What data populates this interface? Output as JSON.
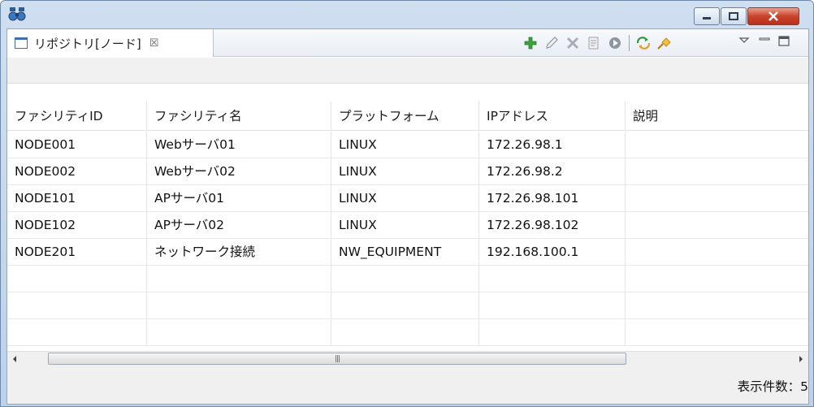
{
  "view": {
    "tab_title": "リポジトリ[ノード]",
    "tab_close_glyph": "☒"
  },
  "toolbar": {
    "items": [
      {
        "name": "add-icon"
      },
      {
        "name": "edit-icon"
      },
      {
        "name": "delete-icon"
      },
      {
        "name": "copy-icon"
      },
      {
        "name": "enable-icon"
      },
      {
        "name": "refresh-icon"
      },
      {
        "name": "pin-icon"
      }
    ]
  },
  "table": {
    "columns": [
      "ファシリティID",
      "ファシリティ名",
      "プラットフォーム",
      "IPアドレス",
      "説明"
    ],
    "rows": [
      [
        "NODE001",
        "Webサーバ01",
        "LINUX",
        "172.26.98.1",
        ""
      ],
      [
        "NODE002",
        "Webサーバ02",
        "LINUX",
        "172.26.98.2",
        ""
      ],
      [
        "NODE101",
        "APサーバ01",
        "LINUX",
        "172.26.98.101",
        ""
      ],
      [
        "NODE102",
        "APサーバ02",
        "LINUX",
        "172.26.98.102",
        ""
      ],
      [
        "NODE201",
        "ネットワーク接続",
        "NW_EQUIPMENT",
        "192.168.100.1",
        ""
      ],
      [
        "",
        "",
        "",
        "",
        ""
      ],
      [
        "",
        "",
        "",
        "",
        ""
      ],
      [
        "",
        "",
        "",
        "",
        ""
      ]
    ]
  },
  "status": {
    "count_text": "表示件数：5"
  },
  "colors": {
    "accent_blue": "#3d6fb3",
    "add_green": "#3aa33a",
    "close_red": "#c8442a"
  }
}
